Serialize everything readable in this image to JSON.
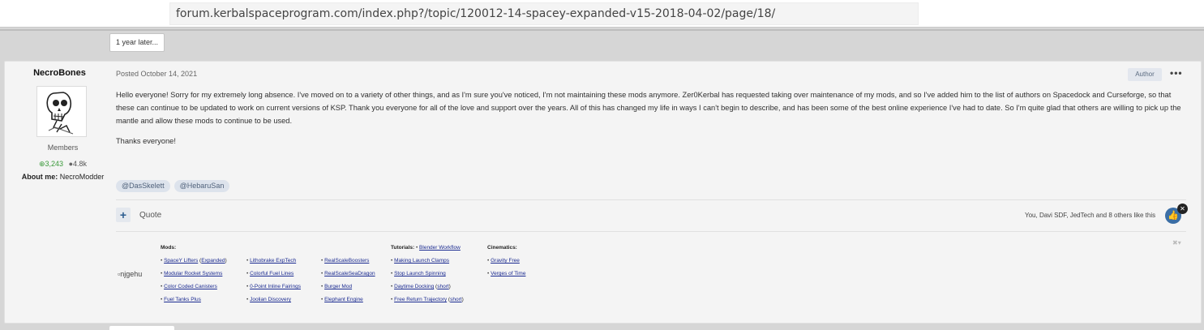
{
  "browser": {
    "url": "forum.kerbalspaceprogram.com/index.php?/topic/120012-14-spacey-expanded-v15-2018-04-02/page/18/"
  },
  "thread": {
    "gap_label": "1 year later..."
  },
  "post": {
    "author": {
      "name": "NecroBones",
      "group": "Members",
      "reputation": "3,243",
      "post_count": "4.8k",
      "about_label": "About me:",
      "about_value": "NecroModder"
    },
    "posted": "Posted October 14, 2021",
    "author_badge": "Author",
    "more_icon": "•••",
    "body": "Hello everyone! Sorry for my extremely long absence. I've moved on to a variety of other things, and as I'm sure you've noticed, I'm not maintaining these mods anymore. Zer0Kerbal has requested taking over maintenance of my mods, and so I've added him to the list of authors on Spacedock and Curseforge, so that these can continue to be updated to work on current versions of KSP. Thank you everyone for all of the love and support over the years. All of this has changed my life in ways I can't begin to describe, and has been some of the best online experience I've had to date. So I'm quite glad that others are willing to pick up the mantle and allow these mods to continue to be used.",
    "thanks": "Thanks everyone!",
    "tags": [
      "@DasSkelett",
      "@HebaruSan"
    ],
    "actions": {
      "plus_label": "+",
      "quote_label": "Quote",
      "likes_text": "You, Davi SDF, JedTech and 8 others like this",
      "like_icon": "thumbs-up",
      "remove_like": "✕"
    },
    "signature": {
      "image_alt": "njgehu",
      "close_label": "✖▾",
      "mods_header": "Mods:",
      "mods_col1": [
        {
          "link": "SpaceY Lifters",
          "extra": "Expanded"
        },
        {
          "link": "Modular Rocket Systems"
        },
        {
          "link": "Color Coded Canisters"
        },
        {
          "link": "Fuel Tanks Plus"
        }
      ],
      "mods_col2": [
        {
          "link": "Lithobrake ExpTech"
        },
        {
          "link": "Colorful Fuel Lines"
        },
        {
          "link": "0-Point Inline Fairings"
        },
        {
          "link": "Joolian Discovery"
        }
      ],
      "mods_col3": [
        {
          "link": "RealScaleBoosters"
        },
        {
          "link": "RealScaleSeaDragon"
        },
        {
          "link": "Burger Mod"
        },
        {
          "link": "Elephant Engine"
        }
      ],
      "tutorials_header": "Tutorials:",
      "tutorials_first": "Blender Workflow",
      "tutorials": [
        {
          "link": "Making Launch Clamps"
        },
        {
          "link": "Stop Launch Spinning"
        },
        {
          "link": "Daytime Docking",
          "extra": "short"
        },
        {
          "link": "Free Return Trajectory",
          "extra": "short"
        }
      ],
      "cinematics_header": "Cinematics:",
      "cinematics": [
        {
          "link": "Gravity Free"
        },
        {
          "link": "Verges of Time"
        }
      ]
    }
  }
}
